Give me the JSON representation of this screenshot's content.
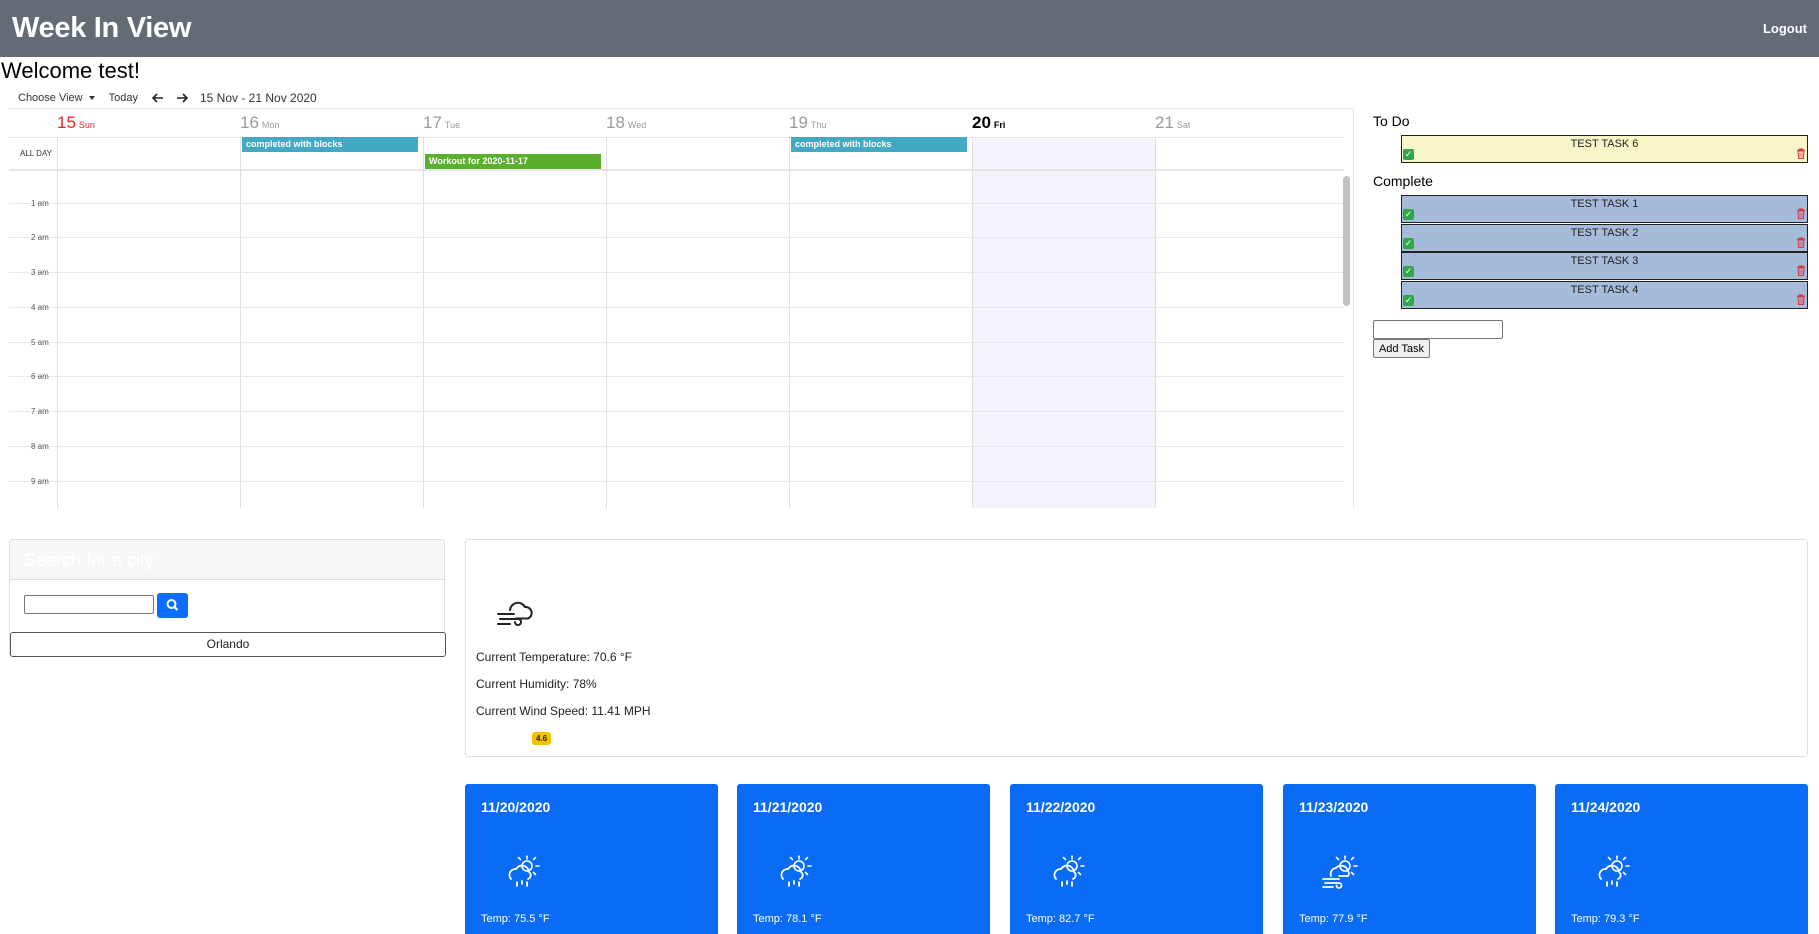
{
  "app": {
    "title": "Week In View",
    "logout_label": "Logout"
  },
  "welcome": "Welcome test!",
  "calendar": {
    "toolbar": {
      "choose_view": "Choose View",
      "today": "Today",
      "prev": "🡐",
      "next": "🡒",
      "range": "15 Nov - 21 Nov 2020"
    },
    "days": [
      {
        "num": "15",
        "dow": "Sun"
      },
      {
        "num": "16",
        "dow": "Mon"
      },
      {
        "num": "17",
        "dow": "Tue"
      },
      {
        "num": "18",
        "dow": "Wed"
      },
      {
        "num": "19",
        "dow": "Thu"
      },
      {
        "num": "20",
        "dow": "Fri"
      },
      {
        "num": "21",
        "dow": "Sat"
      }
    ],
    "allday_label": "ALL DAY",
    "hours": [
      "1 am",
      "2 am",
      "3 am",
      "4 am",
      "5 am",
      "6 am",
      "7 am",
      "8 am",
      "9 am"
    ],
    "events": [
      {
        "title": "completed with blocks",
        "day": "Mon"
      },
      {
        "title": "Workout for 2020-11-17",
        "day": "Tue"
      },
      {
        "title": "completed with blocks",
        "day": "Thu"
      }
    ]
  },
  "tasks": {
    "todo_title": "To Do",
    "complete_title": "Complete",
    "todo": [
      {
        "label": "TEST TASK 6"
      }
    ],
    "complete": [
      {
        "label": "TEST TASK 1"
      },
      {
        "label": "TEST TASK 2"
      },
      {
        "label": "TEST TASK 3"
      },
      {
        "label": "TEST TASK 4"
      }
    ],
    "add_button": "Add Task",
    "input_value": ""
  },
  "weather": {
    "search_title": "Search for a city:",
    "search_value": "",
    "history": [
      "Orlando"
    ],
    "current": {
      "temperature": "Current Temperature: 70.6 °F",
      "humidity": "Current Humidity: 78%",
      "wind": "Current Wind Speed: 11.41 MPH",
      "uv": "4.6",
      "icon": "windy-cloud-icon"
    },
    "forecast": [
      {
        "date": "11/20/2020",
        "temp": "Temp: 75.5 °F",
        "icon": "sun-rain-icon"
      },
      {
        "date": "11/21/2020",
        "temp": "Temp: 78.1 °F",
        "icon": "sun-rain-icon"
      },
      {
        "date": "11/22/2020",
        "temp": "Temp: 82.7 °F",
        "icon": "sun-rain-icon"
      },
      {
        "date": "11/23/2020",
        "temp": "Temp: 77.9 °F",
        "icon": "sun-wind-icon"
      },
      {
        "date": "11/24/2020",
        "temp": "Temp: 79.3 °F",
        "icon": "sun-rain-icon"
      }
    ]
  },
  "colors": {
    "navbar": "#636b75",
    "todo_task": "#f7f6c9",
    "complete_task": "#a6bad9",
    "event_cyan": "#43a9c2",
    "event_green": "#5aaf2c",
    "forecast": "#0a6cf5",
    "uv_badge": "#f5c000",
    "sunday": "#e5252a"
  }
}
